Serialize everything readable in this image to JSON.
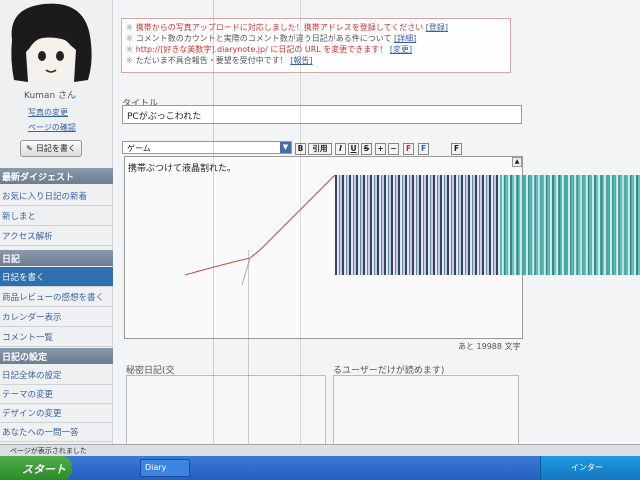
{
  "sidebar": {
    "user_name": "Kuman さん",
    "links": [
      "写真の変更",
      "ページの確認"
    ],
    "write_button": "日記を書く",
    "section1_title": "最新ダイジェスト",
    "section1_items": [
      "お気に入り日記の新着",
      "新しまと",
      "アクセス解析"
    ],
    "section2_title": "日記",
    "section2_items": [
      "日記を書く",
      "商品レビューの感想を書く",
      "カレンダー表示",
      "コメント一覧"
    ],
    "section3_title": "日記の設定",
    "section3_items": [
      "日記全体の設定",
      "テーマの変更",
      "デザインの変更",
      "あなたへの一問一答"
    ]
  },
  "notice": {
    "line1_text": "携帯からの写真アップロードに対応しました！携帯アドレスを登録してください",
    "line1_link": "[登録]",
    "line2_text": "コメント数のカウントと実際のコメント数が違う日記がある件について",
    "line2_link": "[詳細]",
    "line3_text": "http://[好きな英数字].diarynote.jp/ に日記の URL を変更できます！",
    "line3_link": "[変更]",
    "line4_text": "ただいま不具合報告・要望を受付中です！",
    "line4_link": "[報告]"
  },
  "editor": {
    "title_label": "タイトル",
    "title_value": "PCがぶっこわれた",
    "category_value": "ゲーム",
    "toolbar": [
      "B",
      "引用",
      "I",
      "U",
      "S",
      "+",
      "−",
      "F",
      "F",
      "F"
    ],
    "body_text": "携帯ぶつけて液晶割れた。",
    "counter": "あと 19988 文字"
  },
  "secret": {
    "label_left": "秘密日記(交",
    "label_right": "るユーザーだけが読めます)"
  },
  "status": {
    "text": "ページが表示されました"
  },
  "taskbar": {
    "start_label": "スタート",
    "task_label": "Diary",
    "tray_label": "インター"
  }
}
